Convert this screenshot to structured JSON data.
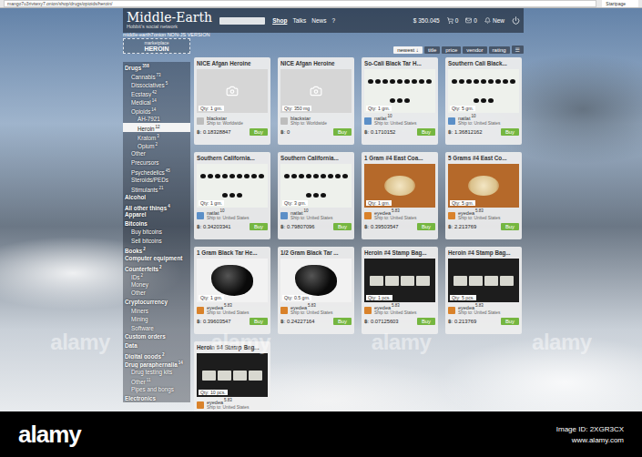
{
  "browser": {
    "url": "mango7u3rivtwxy7.onion/shop/drugs/opioids/heroin/",
    "tab": "Startpage"
  },
  "header": {
    "title": "Middle-Earth",
    "subtitle": "Hobbit's social network",
    "nav": [
      {
        "label": "Shop",
        "selected": true
      },
      {
        "label": "Talks",
        "selected": false
      },
      {
        "label": "News",
        "selected": false
      },
      {
        "label": "?",
        "selected": false
      }
    ],
    "balance": "$ 350.045",
    "counters": [
      {
        "kind": "cart",
        "value": "0"
      },
      {
        "kind": "mail",
        "value": "0"
      },
      {
        "kind": "alert",
        "value": "New"
      }
    ]
  },
  "subbar": {
    "site": "middle-earth7onion",
    "version": "NON-JS VERSION",
    "crumb": "marketplace",
    "page": "HEROIN"
  },
  "sort": {
    "options": [
      {
        "label": "newest ↓",
        "selected": true
      },
      {
        "label": "title",
        "selected": false
      },
      {
        "label": "price",
        "selected": false
      },
      {
        "label": "vendor",
        "selected": false
      },
      {
        "label": "rating",
        "selected": false
      }
    ],
    "menu": "☰"
  },
  "sidebar": [
    {
      "label": "Drugs",
      "count": "358",
      "depth": 0,
      "selected": false
    },
    {
      "label": "Cannabis",
      "count": "73",
      "depth": 1,
      "selected": false
    },
    {
      "label": "Dissociatives",
      "count": "5",
      "depth": 1,
      "selected": false
    },
    {
      "label": "Ecstasy",
      "count": "42",
      "depth": 1,
      "selected": false
    },
    {
      "label": "Medical",
      "count": "14",
      "depth": 1,
      "selected": false
    },
    {
      "label": "Opioids",
      "count": "14",
      "depth": 1,
      "selected": false
    },
    {
      "label": "AH-7921",
      "count": "",
      "depth": 2,
      "selected": false
    },
    {
      "label": "Heroin",
      "count": "12",
      "depth": 2,
      "selected": true
    },
    {
      "label": "Kratom",
      "count": "3",
      "depth": 2,
      "selected": false
    },
    {
      "label": "Opium",
      "count": "2",
      "depth": 2,
      "selected": false
    },
    {
      "label": "Other",
      "count": "",
      "depth": 1,
      "selected": false
    },
    {
      "label": "Precursors",
      "count": "",
      "depth": 1,
      "selected": false
    },
    {
      "label": "Psychedelics",
      "count": "45",
      "depth": 1,
      "selected": false
    },
    {
      "label": "Steroids/PEDs",
      "count": "",
      "depth": 1,
      "selected": false
    },
    {
      "label": "Stimulants",
      "count": "21",
      "depth": 1,
      "selected": false
    },
    {
      "label": "Alcohol",
      "count": "",
      "depth": 0,
      "selected": false
    },
    {
      "label": "All other things",
      "count": "4",
      "depth": 0,
      "selected": false
    },
    {
      "label": "Apparel",
      "count": "",
      "depth": 0,
      "selected": false
    },
    {
      "label": "Bitcoins",
      "count": "",
      "depth": 0,
      "selected": false
    },
    {
      "label": "Buy bitcoins",
      "count": "",
      "depth": 1,
      "selected": false
    },
    {
      "label": "Sell bitcoins",
      "count": "",
      "depth": 1,
      "selected": false
    },
    {
      "label": "Books",
      "count": "2",
      "depth": 0,
      "selected": false
    },
    {
      "label": "Computer equipment",
      "count": "",
      "depth": 0,
      "selected": false
    },
    {
      "label": "Counterfeits",
      "count": "2",
      "depth": 0,
      "selected": false
    },
    {
      "label": "IDs",
      "count": "2",
      "depth": 1,
      "selected": false
    },
    {
      "label": "Money",
      "count": "",
      "depth": 1,
      "selected": false
    },
    {
      "label": "Other",
      "count": "",
      "depth": 1,
      "selected": false
    },
    {
      "label": "Cryptocurrency",
      "count": "",
      "depth": 0,
      "selected": false
    },
    {
      "label": "Miners",
      "count": "",
      "depth": 1,
      "selected": false
    },
    {
      "label": "Mining",
      "count": "",
      "depth": 1,
      "selected": false
    },
    {
      "label": "Software",
      "count": "",
      "depth": 1,
      "selected": false
    },
    {
      "label": "Custom orders",
      "count": "",
      "depth": 0,
      "selected": false
    },
    {
      "label": "Data",
      "count": "",
      "depth": 0,
      "selected": false
    },
    {
      "label": "Digital goods",
      "count": "2",
      "depth": 0,
      "selected": false
    },
    {
      "label": "Drug paraphernalia",
      "count": "14",
      "depth": 0,
      "selected": false
    },
    {
      "label": "Drug testing kits",
      "count": "",
      "depth": 1,
      "selected": false
    },
    {
      "label": "Other",
      "count": "11",
      "depth": 1,
      "selected": false
    },
    {
      "label": "Pipes and bongs",
      "count": "",
      "depth": 1,
      "selected": false
    },
    {
      "label": "Electronics",
      "count": "",
      "depth": 0,
      "selected": false
    }
  ],
  "cards": [
    {
      "title": "NICE Afgan Heroine",
      "image": "placeholder",
      "qty": "Qty: 1 gm.",
      "vendor": "blackstar",
      "rating": "",
      "color": "#bdbdbd",
      "ship": "Ship to: Worldwide",
      "currency": "฿:",
      "price": "0.18328847",
      "button": "Buy"
    },
    {
      "title": "NICE Afgan Heroine",
      "image": "placeholder",
      "qty": "Qty: 350 mg",
      "vendor": "blackstar",
      "rating": "",
      "color": "#bdbdbd",
      "ship": "Ship to: Worldwide",
      "currency": "฿:",
      "price": "0",
      "button": "Buy"
    },
    {
      "title": "So-Cali Black Tar H...",
      "image": "tar-spots",
      "qty": "Qty: 1 gm.",
      "vendor": "natlat",
      "rating": "10",
      "color": "#5b8fc7",
      "ship": "Ship to: United States",
      "currency": "฿:",
      "price": "0.1710152",
      "button": "Buy"
    },
    {
      "title": "Southern Cali Black...",
      "image": "tar-spots",
      "qty": "Qty: 5 gm.",
      "vendor": "natlat",
      "rating": "10",
      "color": "#5b8fc7",
      "ship": "Ship to: United States",
      "currency": "฿:",
      "price": "1.36812162",
      "button": "Buy"
    },
    {
      "title": "Southern California...",
      "image": "tar-spots",
      "qty": "Qty: 1 gm.",
      "vendor": "natlat",
      "rating": "10",
      "color": "#5b8fc7",
      "ship": "Ship to: United States",
      "currency": "฿:",
      "price": "0.34203341",
      "button": "Buy"
    },
    {
      "title": "Southern California...",
      "image": "tar-spots",
      "qty": "Qty: 3 gm.",
      "vendor": "natlat",
      "rating": "10",
      "color": "#5b8fc7",
      "ship": "Ship to: United States",
      "currency": "฿:",
      "price": "0.79807096",
      "button": "Buy"
    },
    {
      "title": "1 Gram #4 East Coa...",
      "image": "powder",
      "qty": "Qty: 1 gm.",
      "vendor": "eyedea",
      "rating": "5.83",
      "color": "#d9822b",
      "ship": "Ship to: United States",
      "currency": "฿:",
      "price": "0.39503547",
      "button": "Buy"
    },
    {
      "title": "5 Grams #4 East Co...",
      "image": "powder",
      "qty": "Qty: 5 gm.",
      "vendor": "eyedea",
      "rating": "5.83",
      "color": "#d9822b",
      "ship": "Ship to: United States",
      "currency": "฿:",
      "price": "2.213769",
      "button": "Buy"
    },
    {
      "title": "1 Gram Black Tar He...",
      "image": "tar-lump",
      "qty": "Qty: 1 gm.",
      "vendor": "eyedea",
      "rating": "5.83",
      "color": "#d9822b",
      "ship": "Ship to: United States",
      "currency": "฿:",
      "price": "0.39603547",
      "button": "Buy"
    },
    {
      "title": "1/2 Gram Black Tar ...",
      "image": "tar-lump",
      "qty": "Qty: 0.5 gm.",
      "vendor": "eyedea",
      "rating": "5.83",
      "color": "#d9822b",
      "ship": "Ship to: United States",
      "currency": "฿:",
      "price": "0.24227164",
      "button": "Buy"
    },
    {
      "title": "Heroin #4 Stamp Bag...",
      "image": "bags",
      "qty": "Qty: 1 pcs.",
      "vendor": "eyedea",
      "rating": "5.83",
      "color": "#d9822b",
      "ship": "Ship to: United States",
      "currency": "฿:",
      "price": "0.07125603",
      "button": "Buy"
    },
    {
      "title": "Heroin #4 Stamp Bag...",
      "image": "bags",
      "qty": "Qty: 5 pcs.",
      "vendor": "eyedea",
      "rating": "5.83",
      "color": "#d9822b",
      "ship": "Ship to: United States",
      "currency": "฿:",
      "price": "0.213769",
      "button": "Buy"
    },
    {
      "title": "Heroin #4 Stamp Bag...",
      "image": "bags",
      "qty": "Qty: 10 pcs.",
      "vendor": "eyedea",
      "rating": "5.83",
      "color": "#d9822b",
      "ship": "Ship to: United States",
      "currency": "",
      "price": "",
      "button": ""
    }
  ],
  "watermarks": [
    "alamy",
    "alamy",
    "alamy",
    "alamy"
  ],
  "footer": {
    "logo": "alamy",
    "image_id": "Image ID: 2XGR3CX",
    "site": "www.alamy.com"
  }
}
